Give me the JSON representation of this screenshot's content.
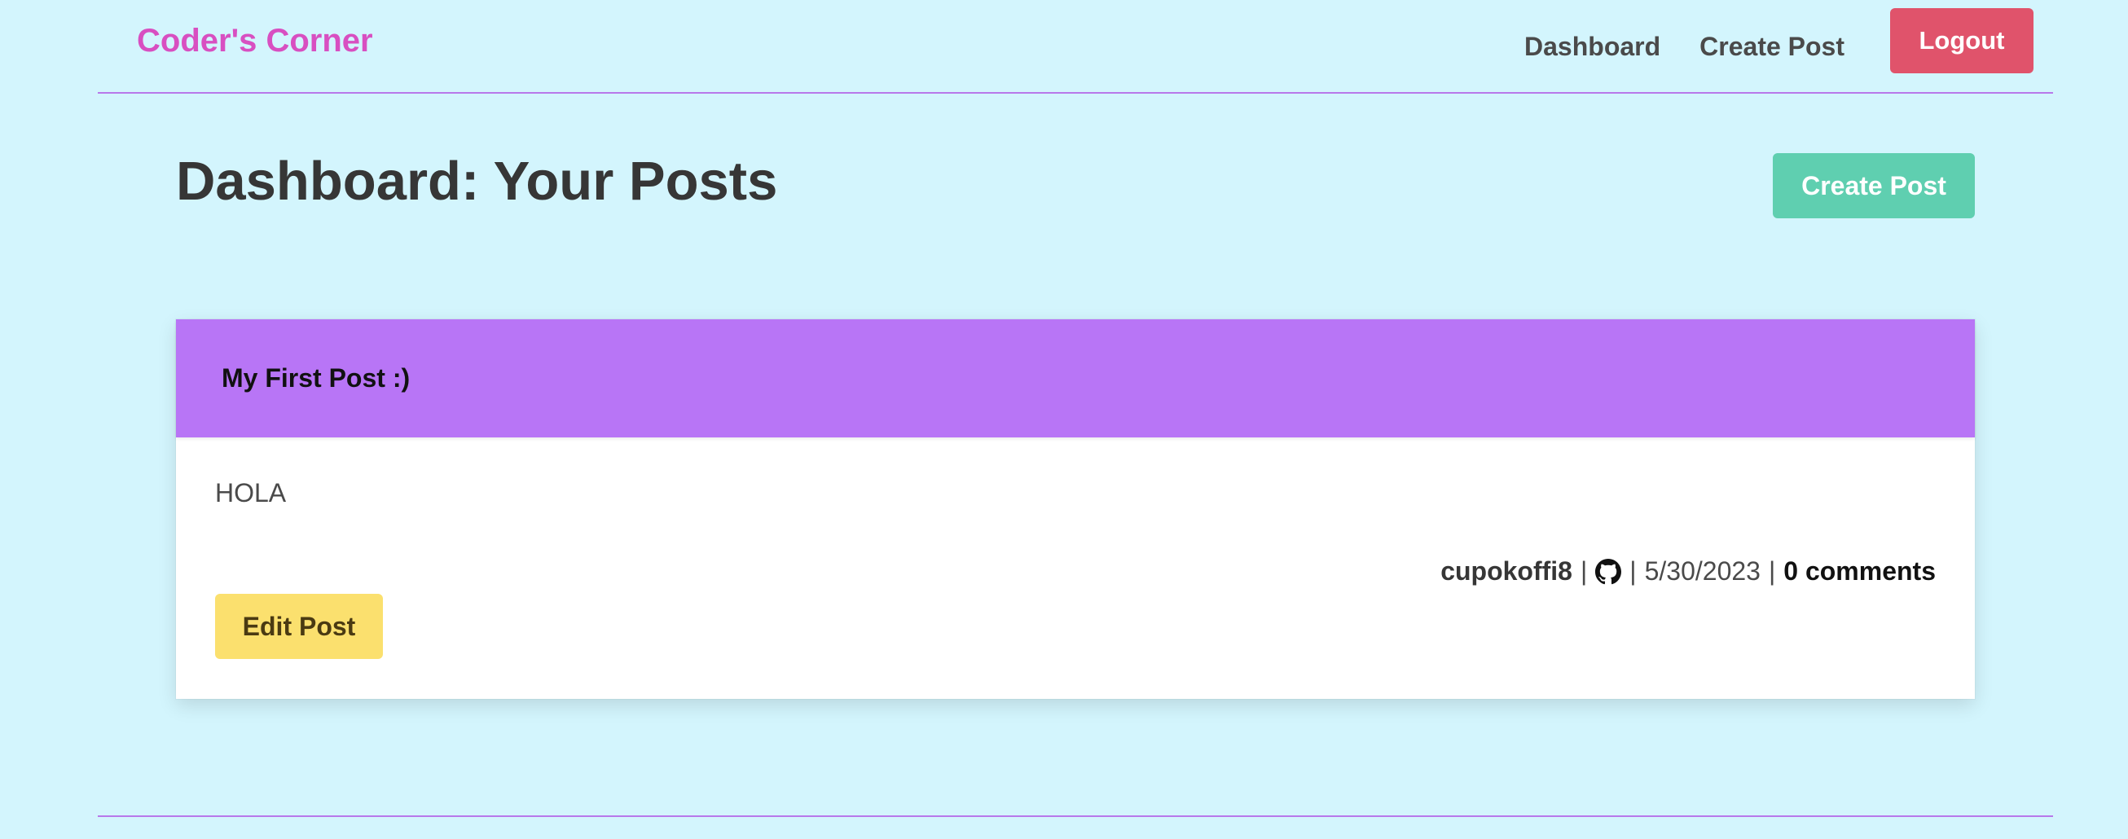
{
  "navbar": {
    "brand": "Coder's Corner",
    "links": [
      "Dashboard",
      "Create Post"
    ],
    "logout_label": "Logout"
  },
  "dashboard": {
    "title": "Dashboard: Your Posts",
    "create_button_label": "Create Post"
  },
  "post": {
    "title": "My First Post :)",
    "content": "HOLA",
    "author": "cupokoffi8",
    "author_icon": "github-icon",
    "separator": "|",
    "date": "5/30/2023",
    "comments": "0 comments",
    "edit_label": "Edit Post"
  },
  "colors": {
    "background": "#d3f5fd",
    "brand": "#d84fc1",
    "divider": "#b878ea",
    "logout": "#e0536b",
    "create": "#5fcfb0",
    "post_header": "#b875f6",
    "edit": "#fbe06e"
  }
}
